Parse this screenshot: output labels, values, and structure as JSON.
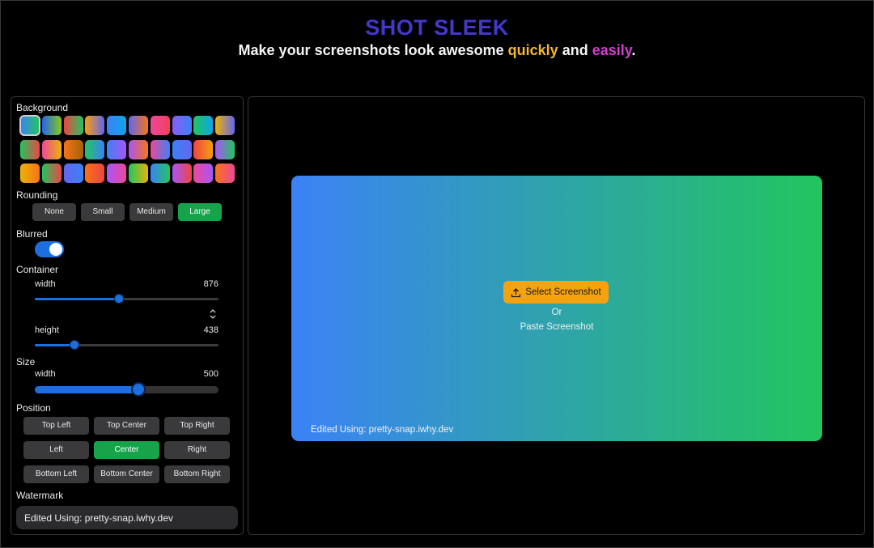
{
  "header": {
    "brand": "SHOT SLEEK",
    "tagline_start": "Make your screenshots look awesome ",
    "tagline_quick": "quickly",
    "tagline_and": " and ",
    "tagline_easy": "easily",
    "tagline_end": "."
  },
  "panel": {
    "background_label": "Background",
    "swatches": [
      [
        "#3b82f6",
        "#22c55e"
      ],
      [
        "#2563eb",
        "#84cc16"
      ],
      [
        "#ef4444",
        "#22c55e"
      ],
      [
        "#f59e0b",
        "#6366f1"
      ],
      [
        "#3b82f6",
        "#0ea5e9"
      ],
      [
        "#6366f1",
        "#f97316"
      ],
      [
        "#ec4899",
        "#f43f5e"
      ],
      [
        "#8b5cf6",
        "#3b82f6"
      ],
      [
        "#22c55e",
        "#0ea5e9"
      ],
      [
        "#eab308",
        "#6366f1"
      ],
      [
        "#22c55e",
        "#ef4444"
      ],
      [
        "#ec4899",
        "#eab308"
      ],
      [
        "#f97316",
        "#a16207"
      ],
      [
        "#22c55e",
        "#3b82f6"
      ],
      [
        "#3b82f6",
        "#a855f7"
      ],
      [
        "#a855f7",
        "#f97316"
      ],
      [
        "#ec4899",
        "#3b82f6"
      ],
      [
        "#3b82f6",
        "#6366f1"
      ],
      [
        "#ef4444",
        "#f59e0b"
      ],
      [
        "#a855f7",
        "#22c55e"
      ],
      [
        "#eab308",
        "#f97316"
      ],
      [
        "#22c55e",
        "#ef4444"
      ],
      [
        "#6366f1",
        "#3b82f6"
      ],
      [
        "#f97316",
        "#ef4444"
      ],
      [
        "#a855f7",
        "#ec4899"
      ],
      [
        "#22c55e",
        "#eab308"
      ],
      [
        "#3b82f6",
        "#22c55e"
      ],
      [
        "#a855f7",
        "#ef4444"
      ],
      [
        "#ec4899",
        "#a855f7"
      ],
      [
        "#f97316",
        "#ec4899"
      ]
    ],
    "rounding_label": "Rounding",
    "rounding_options": [
      "None",
      "Small",
      "Medium",
      "Large"
    ],
    "rounding_selected": "Large",
    "blurred_label": "Blurred",
    "blurred_on": true,
    "container_label": "Container",
    "container_width_label": "width",
    "container_width_value": "876",
    "container_height_label": "height",
    "container_height_value": "438",
    "size_label": "Size",
    "size_width_label": "width",
    "size_width_value": "500",
    "position_label": "Position",
    "position_options": [
      "Top Left",
      "Top Center",
      "Top Right",
      "Left",
      "Center",
      "Right",
      "Bottom Left",
      "Bottom Center",
      "Bottom Right"
    ],
    "position_selected": "Center",
    "watermark_label": "Watermark",
    "watermark_value": "Edited Using: pretty-snap.iwhy.dev"
  },
  "preview": {
    "select_label": "Select Screenshot",
    "or_label": "Or",
    "paste_label": "Paste Screenshot",
    "watermark_text": "Edited Using: pretty-snap.iwhy.dev"
  },
  "colors": {
    "accent_blue": "#1d6fe0",
    "active_green": "#16a34a",
    "brand": "#4338ca",
    "select_orange": "#f5a211"
  }
}
